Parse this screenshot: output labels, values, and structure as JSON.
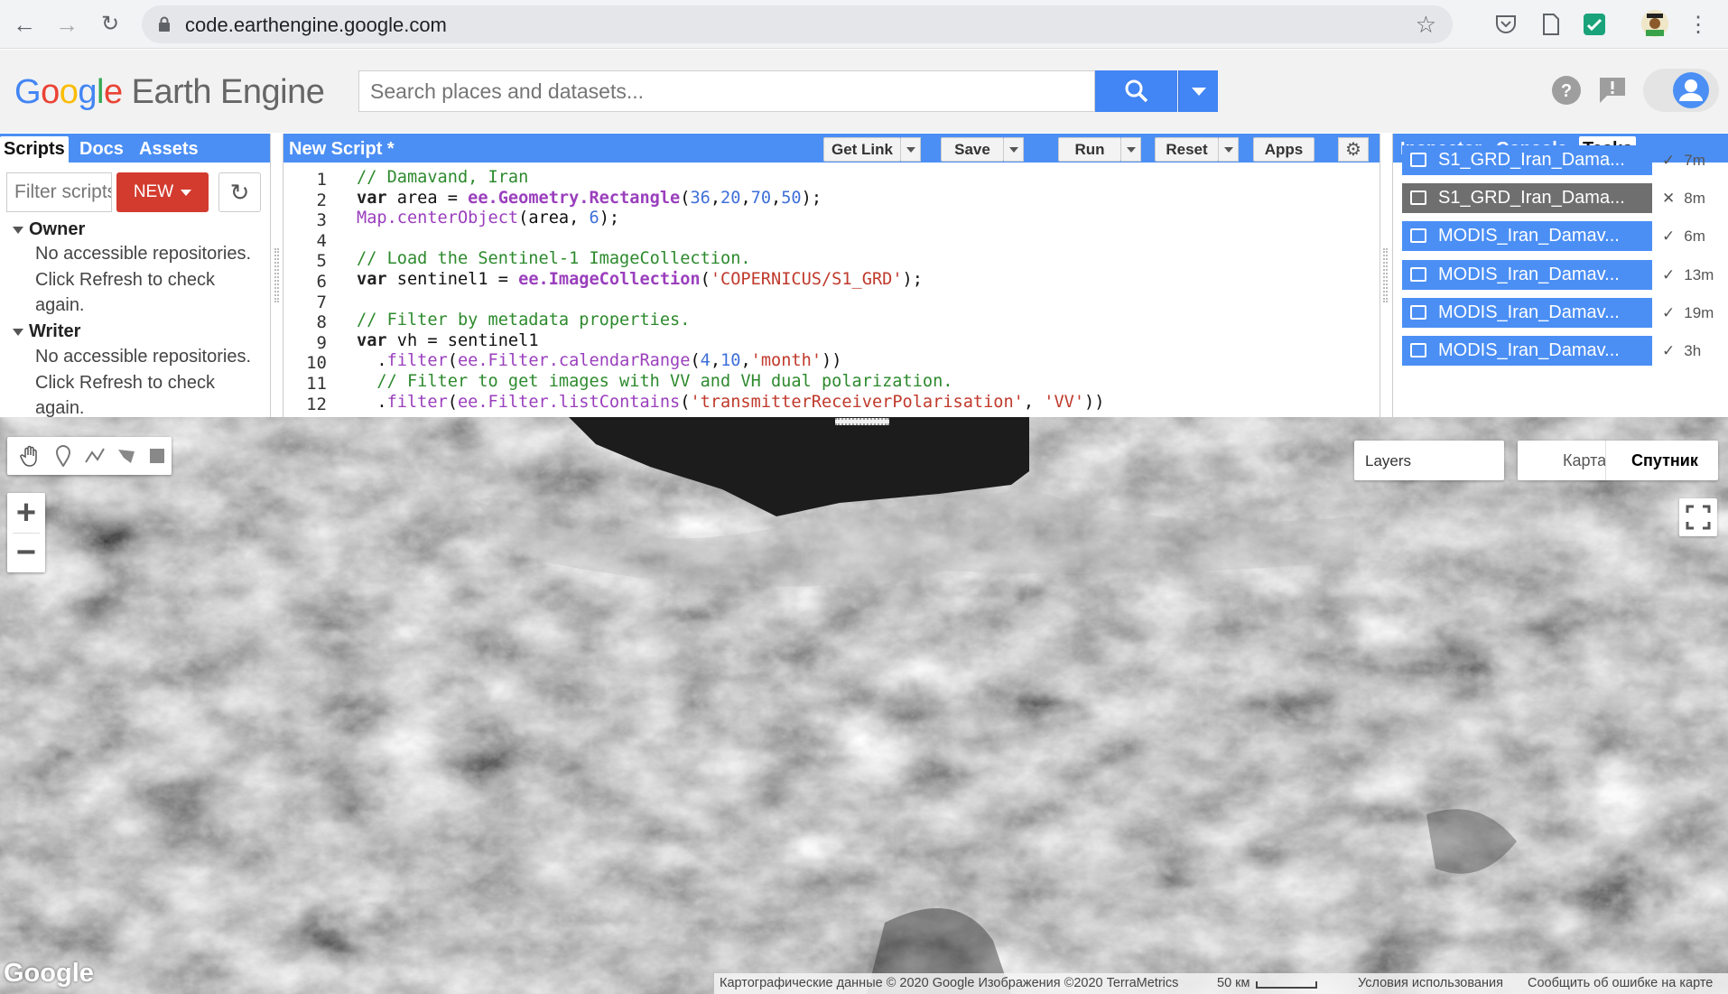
{
  "browser": {
    "url": "code.earthengine.google.com"
  },
  "header": {
    "logo_google": "Google",
    "logo_product": "Earth Engine",
    "search_placeholder": "Search places and datasets..."
  },
  "left_panel": {
    "tabs": [
      "Scripts",
      "Docs",
      "Assets"
    ],
    "filter_placeholder": "Filter scripts...",
    "new_label": "NEW",
    "sections": [
      {
        "title": "Owner",
        "text": "No accessible repositories. Click Refresh to check again."
      },
      {
        "title": "Writer",
        "text": "No accessible repositories. Click Refresh to check again."
      }
    ]
  },
  "editor": {
    "title": "New Script *",
    "buttons": {
      "get_link": "Get Link",
      "save": "Save",
      "run": "Run",
      "reset": "Reset",
      "apps": "Apps"
    },
    "lines": [
      "// Damavand, Iran",
      "var area = ee.Geometry.Rectangle(36,20,70,50);",
      "Map.centerObject(area, 6);",
      "",
      "// Load the Sentinel-1 ImageCollection.",
      "var sentinel1 = ee.ImageCollection('COPERNICUS/S1_GRD');",
      "",
      "// Filter by metadata properties.",
      "var vh = sentinel1",
      "  .filter(ee.Filter.calendarRange(4,10,'month'))",
      "  // Filter to get images with VV and VH dual polarization.",
      "  .filter(ee.Filter.listContains('transmitterReceiverPolarisation', 'VV'))"
    ]
  },
  "right_panel": {
    "tabs": [
      "Inspector",
      "Console",
      "Tasks"
    ],
    "tasks": [
      {
        "name": "S1_GRD_Iran_Dama...",
        "status_icon": "check",
        "age": "7m",
        "state": "done"
      },
      {
        "name": "S1_GRD_Iran_Dama...",
        "status_icon": "cross",
        "age": "8m",
        "state": "failed"
      },
      {
        "name": "MODIS_Iran_Damav...",
        "status_icon": "check",
        "age": "6m",
        "state": "done"
      },
      {
        "name": "MODIS_Iran_Damav...",
        "status_icon": "check",
        "age": "13m",
        "state": "done"
      },
      {
        "name": "MODIS_Iran_Damav...",
        "status_icon": "check",
        "age": "19m",
        "state": "done"
      },
      {
        "name": "MODIS_Iran_Damav...",
        "status_icon": "check",
        "age": "3h",
        "state": "done"
      }
    ]
  },
  "map": {
    "layers_label": "Layers",
    "map_type_map": "Карта",
    "map_type_satellite": "Спутник",
    "watermark": "Google",
    "attribution": "Картографические данные © 2020 Google Изображения ©2020 TerraMetrics",
    "scale": "50 км",
    "terms": "Условия использования",
    "report": "Сообщить об ошибке на карте"
  },
  "colors": {
    "panel_blue": "#4b8ff5",
    "new_red": "#d33b2f",
    "search_blue": "#4285f4"
  }
}
